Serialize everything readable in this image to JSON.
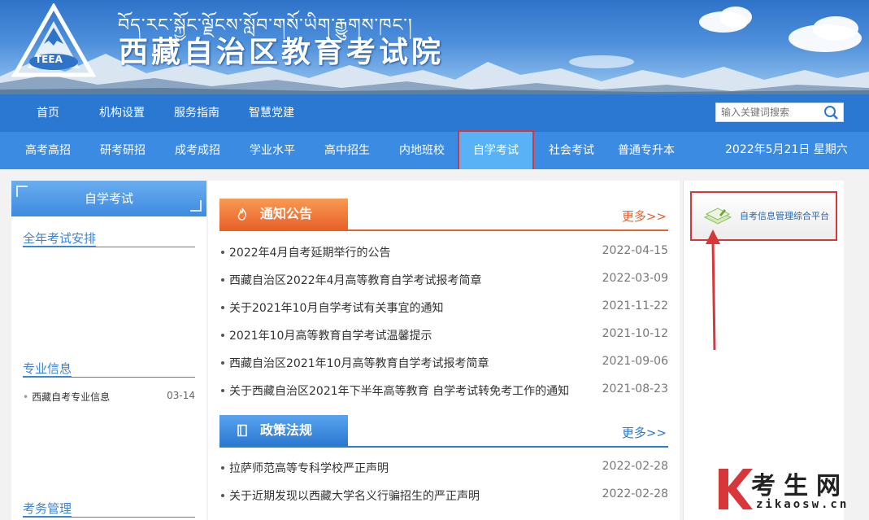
{
  "header": {
    "title_tibetan": "བོད་རང་སྐྱོང་ལྗོངས་སློབ་གསོ་ཡིག་རྒྱུགས་ཁང་།",
    "title_cn": "西藏自治区教育考试院",
    "logo_text": "TEEA"
  },
  "nav_primary": {
    "items": [
      {
        "label": "首页"
      },
      {
        "label": "机构设置"
      },
      {
        "label": "服务指南"
      },
      {
        "label": "智慧党建"
      }
    ],
    "search_placeholder": "输入关键词搜索"
  },
  "nav_secondary": {
    "items": [
      {
        "label": "高考高招"
      },
      {
        "label": "研考研招"
      },
      {
        "label": "成考成招"
      },
      {
        "label": "学业水平"
      },
      {
        "label": "高中招生"
      },
      {
        "label": "内地班校"
      },
      {
        "label": "自学考试",
        "active": true
      },
      {
        "label": "社会考试"
      },
      {
        "label": "普通专升本"
      }
    ],
    "date": "2022年5月21日 星期六"
  },
  "sidebar": {
    "title": "自学考试",
    "sections": [
      {
        "title": "全年考试安排",
        "items": []
      },
      {
        "title": "专业信息",
        "items": [
          {
            "text": "西藏自考专业信息",
            "date": "03-14"
          }
        ]
      },
      {
        "title": "考务管理",
        "items": []
      }
    ]
  },
  "notice": {
    "title": "通知公告",
    "more": "更多>>",
    "items": [
      {
        "text": "2022年4月自考延期举行的公告",
        "date": "2022-04-15"
      },
      {
        "text": "西藏自治区2022年4月高等教育自学考试报考简章",
        "date": "2022-03-09"
      },
      {
        "text": "关于2021年10月自学考试有关事宜的通知",
        "date": "2021-11-22"
      },
      {
        "text": "2021年10月高等教育自学考试温馨提示",
        "date": "2021-10-12"
      },
      {
        "text": "西藏自治区2021年10月高等教育自学考试报考简章",
        "date": "2021-09-06"
      },
      {
        "text": "关于西藏自治区2021年下半年高等教育 自学考试转免考工作的通知",
        "date": "2021-08-23"
      }
    ]
  },
  "policy": {
    "title": "政策法规",
    "more": "更多>>",
    "items": [
      {
        "text": "拉萨师范高等专科学校严正声明",
        "date": "2022-02-28"
      },
      {
        "text": "关于近期发现以西藏大学名义行骗招生的严正声明",
        "date": "2022-02-28"
      }
    ]
  },
  "right_panel": {
    "platform_label": "自考信息管理综合平台"
  },
  "watermark": {
    "big": "考生网",
    "small": "zikaosw.cn"
  },
  "colors": {
    "nav_primary": "#2a78d2",
    "nav_secondary": "#3c8be3",
    "accent_orange": "#e8612b",
    "accent_blue": "#2d7bd2",
    "highlight_red": "#d9363a"
  }
}
